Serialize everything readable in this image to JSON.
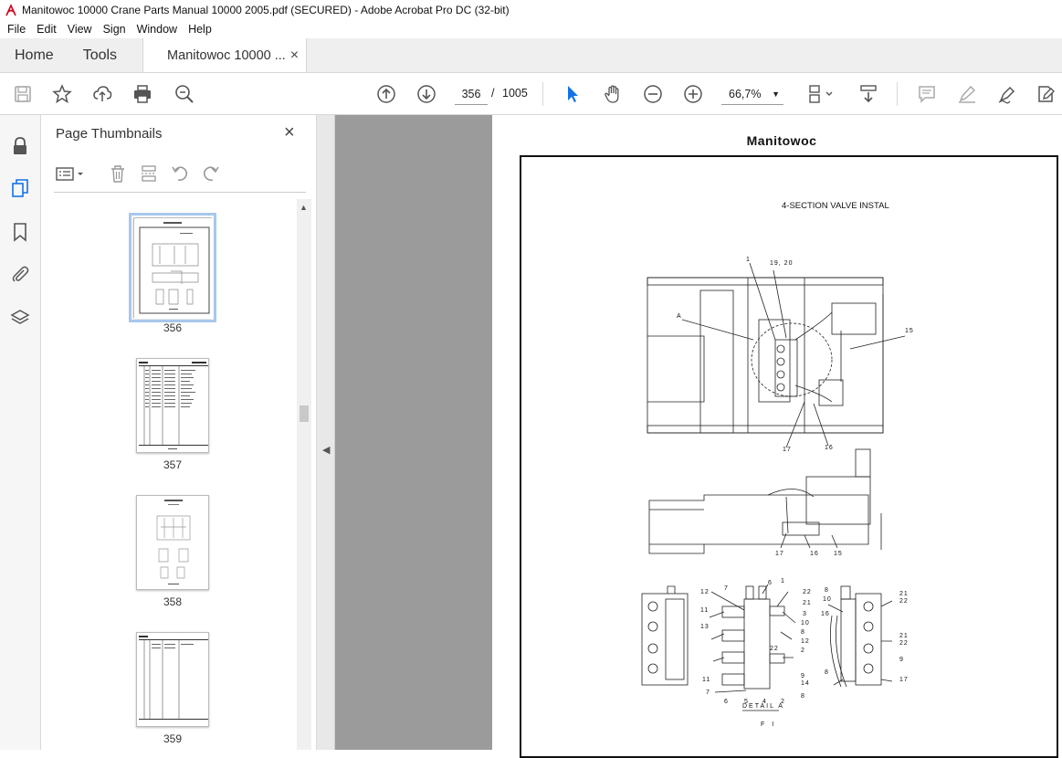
{
  "window": {
    "title": "Manitowoc 10000 Crane Parts Manual 10000 2005.pdf (SECURED) - Adobe Acrobat Pro DC (32-bit)"
  },
  "menu": [
    "File",
    "Edit",
    "View",
    "Sign",
    "Window",
    "Help"
  ],
  "tabs": {
    "home": "Home",
    "tools": "Tools",
    "document": "Manitowoc 10000 ...",
    "close": "×"
  },
  "toolbar": {
    "current_page": "356",
    "page_separator": "/",
    "total_pages": "1005",
    "zoom": "66,7%"
  },
  "thumbnail_panel": {
    "title": "Page Thumbnails",
    "close": "×",
    "thumbnails": [
      {
        "label": "356",
        "selected": true
      },
      {
        "label": "357",
        "selected": false
      },
      {
        "label": "358",
        "selected": false
      },
      {
        "label": "359",
        "selected": false
      }
    ]
  },
  "document": {
    "header": "Manitowoc",
    "caption": "4-SECTION VALVE INSTAL",
    "detail_label": "DETAIL A",
    "figure_label": "F I",
    "callouts_top": [
      "1",
      "19, 20",
      "A",
      "15",
      "17",
      "16"
    ],
    "callouts_mid": [
      "17",
      "16",
      "15"
    ],
    "callouts_left": [
      "12",
      "11",
      "13",
      "11",
      "7",
      "6",
      "5",
      "4",
      "2"
    ],
    "callouts_center": [
      "7",
      "6",
      "1",
      "22",
      "21",
      "3",
      "10",
      "8",
      "12",
      "2",
      "22",
      "9",
      "14",
      "8"
    ],
    "callouts_right": [
      "8",
      "10",
      "16",
      "21",
      "22",
      "21",
      "22",
      "9",
      "8",
      "17"
    ]
  },
  "colors": {
    "accent": "#1473e6",
    "doc_background": "#9b9b9b"
  }
}
